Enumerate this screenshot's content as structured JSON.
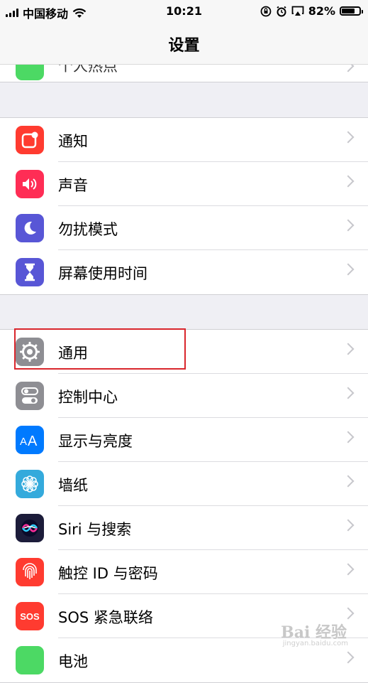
{
  "status_bar": {
    "carrier": "中国移动",
    "time": "10:21",
    "battery_percent_text": "82%",
    "battery_level": 0.82
  },
  "nav": {
    "title": "设置"
  },
  "partial_row": {
    "label": "个人热点",
    "icon_color": "#4cd964"
  },
  "groups": [
    {
      "items": [
        {
          "label": "通知",
          "icon": "notifications-icon",
          "color": "#ff3b30"
        },
        {
          "label": "声音",
          "icon": "sounds-icon",
          "color": "#ff2d55"
        },
        {
          "label": "勿扰模式",
          "icon": "moon-icon",
          "color": "#5856d6"
        },
        {
          "label": "屏幕使用时间",
          "icon": "hourglass-icon",
          "color": "#5856d6"
        }
      ]
    },
    {
      "items": [
        {
          "label": "通用",
          "icon": "gear-icon",
          "color": "#8e8e93"
        },
        {
          "label": "控制中心",
          "icon": "toggles-icon",
          "color": "#8e8e93"
        },
        {
          "label": "显示与亮度",
          "icon": "text-size-icon",
          "color": "#007aff"
        },
        {
          "label": "墙纸",
          "icon": "flower-icon",
          "color": "#34aadc"
        },
        {
          "label": "Siri 与搜索",
          "icon": "siri-icon",
          "color": "#1c1c3a"
        },
        {
          "label": "触控 ID 与密码",
          "icon": "fingerprint-icon",
          "color": "#ff3b30"
        },
        {
          "label": "SOS 紧急联络",
          "icon": "sos-icon",
          "color": "#ff3b30"
        },
        {
          "label": "电池",
          "icon": "battery-icon",
          "color": "#4cd964"
        }
      ]
    }
  ],
  "sos_icon_text": "SOS",
  "watermark": {
    "text": "Bai 经验",
    "sub": "jingyan.baidu.com"
  }
}
